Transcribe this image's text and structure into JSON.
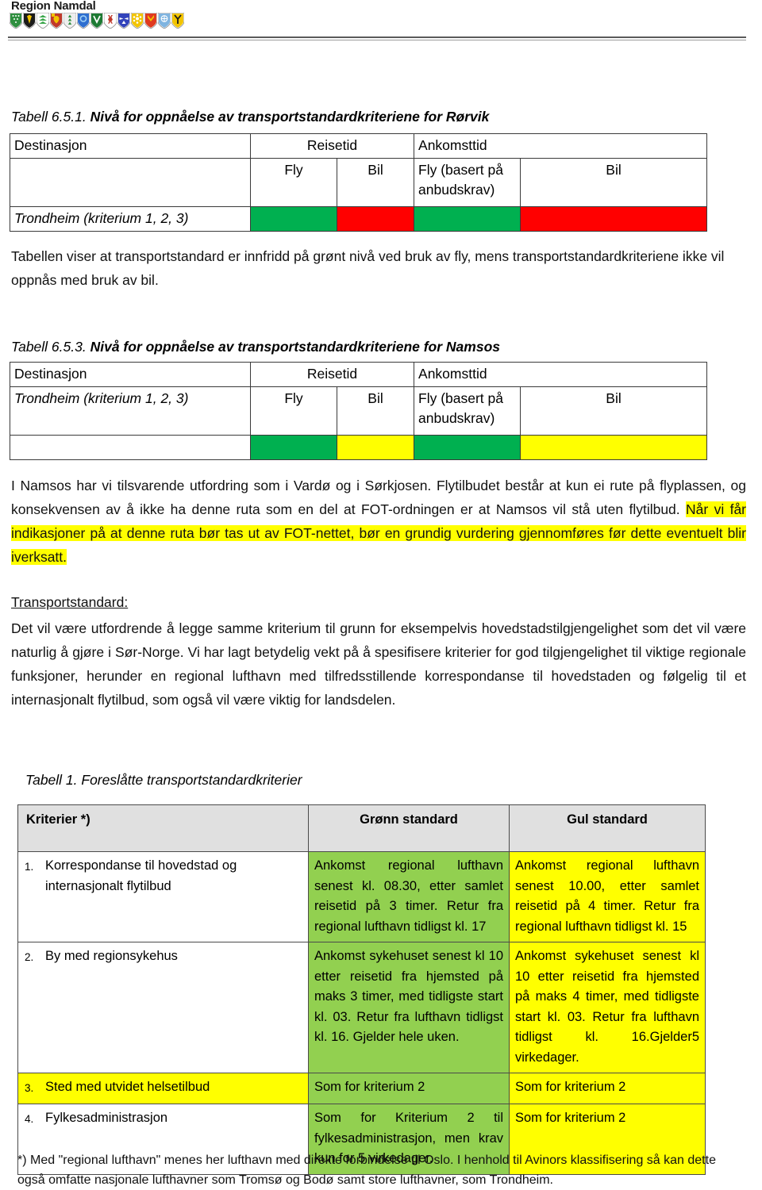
{
  "header": {
    "brand": "Region Namdal",
    "crest_colors": [
      "#2f8f3f",
      "#1b1b1b",
      "#3aa64a",
      "#c0392b",
      "#e8e8e8",
      "#2f6fd0",
      "#1d7a33",
      "#2050c0",
      "#3344bb",
      "#f2c400",
      "#e03a20",
      "#7fb4e0",
      "#f2c400"
    ]
  },
  "table_651": {
    "caption_prefix": "Tabell 6.5.1.",
    "caption_title": "Nivå for oppnåelse av transportstandardkriteriene for Rørvik",
    "headers": {
      "destination": "Destinasjon",
      "reisetid": "Reisetid",
      "ankomsttid": "Ankomsttid",
      "sub_fly": "Fly",
      "sub_bil": "Bil",
      "sub_fly_anbud": "Fly (basert på anbudskrav)",
      "sub_bil2": "Bil"
    },
    "row_label": "Trondheim (kriterium 1, 2, 3)",
    "statuses": [
      "green",
      "red",
      "green",
      "red"
    ]
  },
  "paragraph_rorvik": "Tabellen viser at transportstandard er innfridd på grønt nivå ved bruk av fly, mens transportstandardkriteriene ikke vil oppnås med bruk av bil.",
  "table_653": {
    "caption_prefix": "Tabell 6.5.3.",
    "caption_title": "Nivå for oppnåelse av transportstandardkriteriene for Namsos",
    "headers": {
      "destination": "Destinasjon",
      "reisetid": "Reisetid",
      "ankomsttid": "Ankomsttid",
      "sub_fly": "Fly",
      "sub_bil": "Bil",
      "sub_fly_anbud": "Fly (basert på anbudskrav)",
      "sub_bil2": "Bil"
    },
    "row_label": "Trondheim (kriterium 1, 2, 3)",
    "statuses": [
      "green",
      "yellow",
      "green",
      "yellow"
    ]
  },
  "paragraph_namsos": {
    "plain": "I Namsos har vi tilsvarende utfordring som i Vardø og i Sørkjosen. Flytilbudet består at kun ei rute på flyplassen, og konsekvensen av å ikke ha denne ruta som en del at FOT-ordningen er at Namsos vil stå uten flytilbud. ",
    "highlighted": "Når vi får indikasjoner på at denne ruta bør tas ut av FOT-nettet, bør en grundig vurdering gjennomføres før dette eventuelt blir iverksatt."
  },
  "transportstandard": {
    "heading": "Transportstandard:",
    "body": "Det vil være utfordrende å legge samme kriterium til grunn for eksempelvis hovedstadstilgjengelighet som det vil være naturlig å gjøre i Sør-Norge. Vi har lagt betydelig vekt på å spesifisere kriterier for god tilgjengelighet til viktige regionale funksjoner, herunder en regional lufthavn med tilfredsstillende korrespondanse til hovedstaden og følgelig til et internasjonalt flytilbud, som også vil være viktig for landsdelen."
  },
  "table_1": {
    "caption": "Tabell 1. Foreslåtte transportstandardkriterier",
    "columns": [
      "Kriterier *)",
      "Grønn standard",
      "Gul standard"
    ],
    "rows": [
      {
        "num": "1.",
        "criterion": "Korrespondanse til hovedstad og internasjonalt flytilbud",
        "green": "Ankomst regional lufthavn senest kl. 08.30, etter samlet reisetid på 3 timer. Retur fra regional lufthavn tidligst kl. 17",
        "yellow": "Ankomst regional lufthavn senest 10.00, etter samlet reisetid på 4 timer. Retur fra regional lufthavn tidligst kl. 15",
        "criterion_highlighted": false
      },
      {
        "num": "2.",
        "criterion": "By med regionsykehus",
        "green": "Ankomst sykehuset senest kl 10 etter reisetid fra hjemsted på maks 3 timer, med tidligste start kl. 03. Retur fra lufthavn tidligst kl. 16. Gjelder hele uken.",
        "yellow": "Ankomst sykehuset senest kl 10 etter reisetid fra hjemsted på maks 4 timer, med tidligste start kl. 03. Retur fra lufthavn tidligst kl. 16.Gjelder5 virkedager.",
        "criterion_highlighted": false
      },
      {
        "num": "3.",
        "criterion": "Sted med utvidet helsetilbud",
        "green": "Som for kriterium 2",
        "yellow": "Som for kriterium 2",
        "criterion_highlighted": true
      },
      {
        "num": "4.",
        "criterion": "Fylkesadministrasjon",
        "green": "Som for Kriterium 2 til fylkesadministrasjon, men krav kun for 5 virkedager.",
        "yellow": "Som for kriterium 2",
        "criterion_highlighted": false
      }
    ]
  },
  "footnote": "*) Med \"regional lufthavn\" menes her lufthavn med direkte forbindelse til Oslo. I henhold til Avinors klassifisering så kan dette også omfatte nasjonale lufthavner som Tromsø og Bodø samt store lufthavner, som Trondheim.",
  "colors": {
    "green_status": "#00b050",
    "red_status": "#ff0000",
    "yellow_status": "#ffff00",
    "green_cell": "#92d050",
    "yellow_cell": "#ffff00",
    "header_gray": "#e0e0e0"
  }
}
